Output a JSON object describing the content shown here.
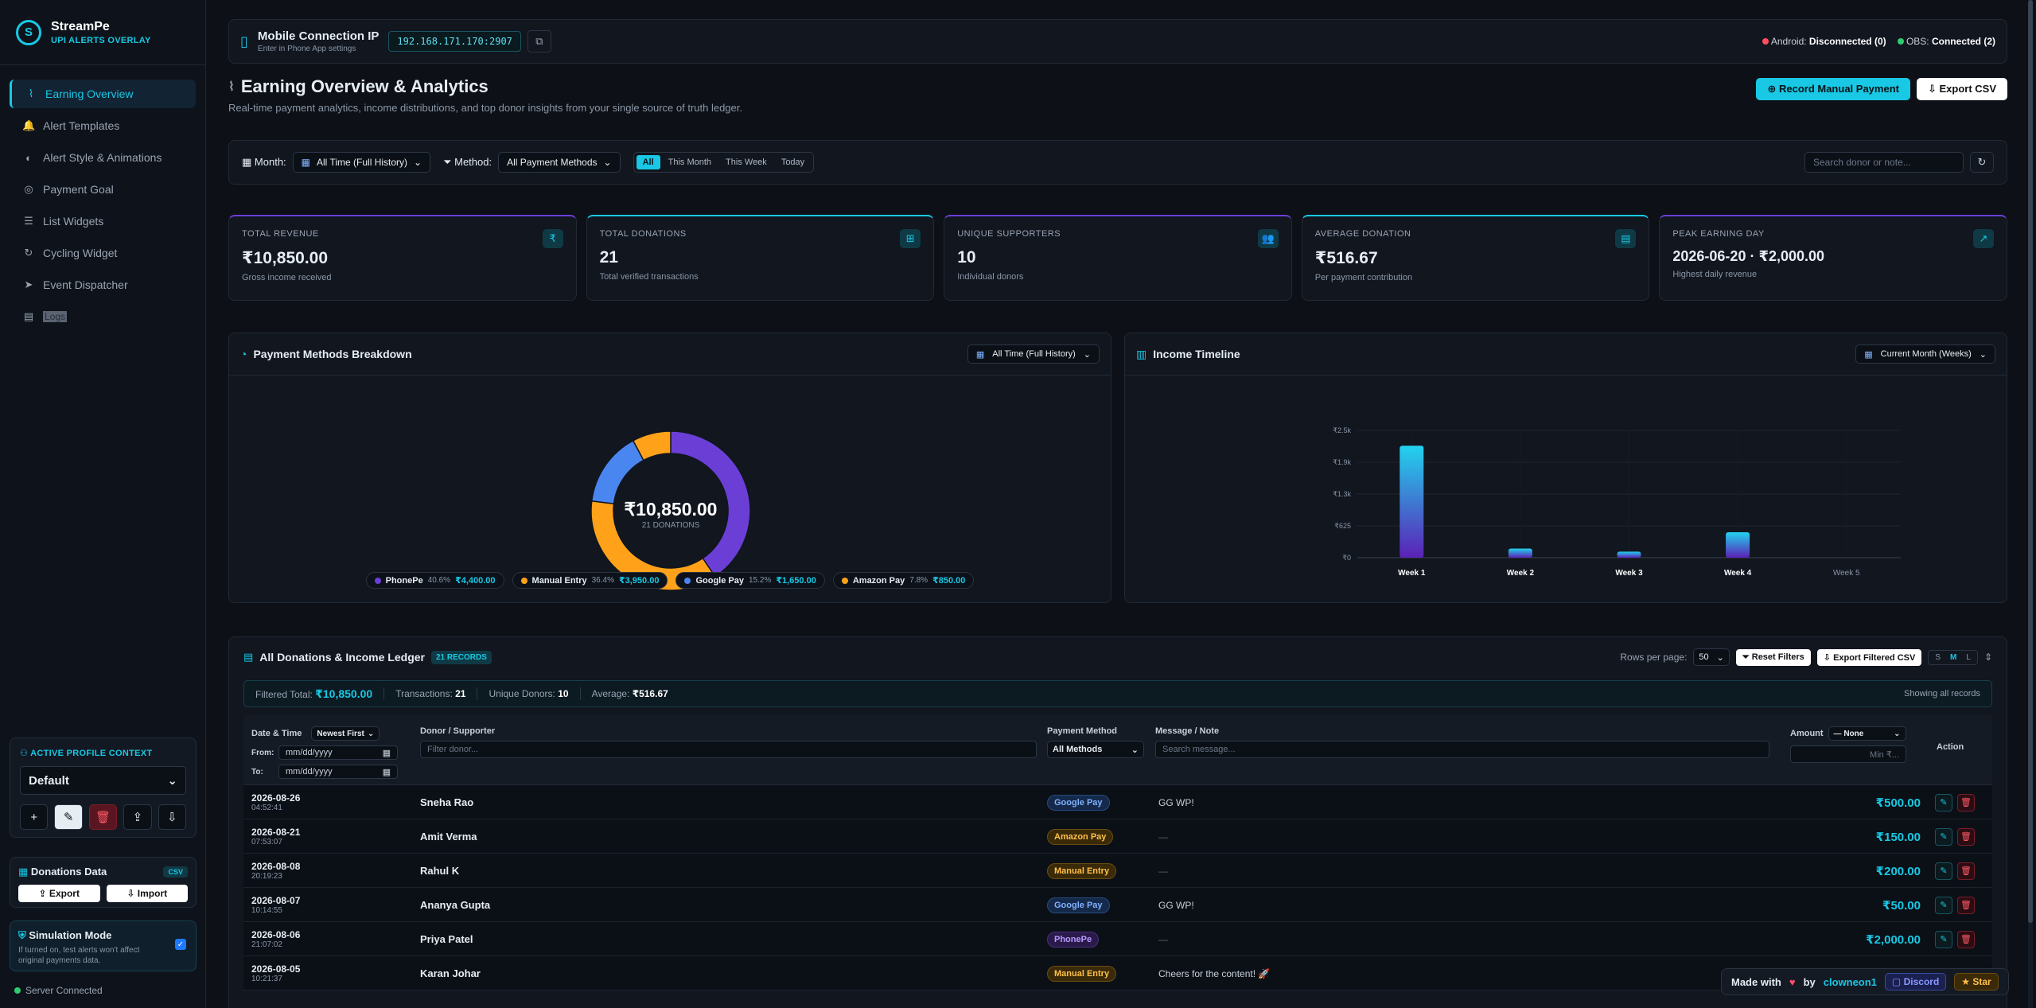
{
  "brand": {
    "name": "StreamPe",
    "sub": "UPI ALERTS OVERLAY",
    "logo": "S"
  },
  "nav": [
    {
      "label": "Earning Overview",
      "icon": "chart-icon",
      "glyph": "⌇"
    },
    {
      "label": "Alert Templates",
      "icon": "bell-icon",
      "glyph": "🔔"
    },
    {
      "label": "Alert Style & Animations",
      "icon": "palette-icon",
      "glyph": "◐"
    },
    {
      "label": "Payment Goal",
      "icon": "target-icon",
      "glyph": "◎"
    },
    {
      "label": "List Widgets",
      "icon": "list-icon",
      "glyph": "☰"
    },
    {
      "label": "Cycling Widget",
      "icon": "cycle-icon",
      "glyph": "↻"
    },
    {
      "label": "Event Dispatcher",
      "icon": "send-icon",
      "glyph": "➤"
    },
    {
      "label": "Logs",
      "icon": "clipboard-icon",
      "glyph": "▤"
    }
  ],
  "profile": {
    "title": "ACTIVE PROFILE CONTEXT",
    "value": "Default",
    "add": "+",
    "edit": "✎",
    "delete": "🗑",
    "upload": "⇪",
    "download": "⇩"
  },
  "donations_data": {
    "title": "Donations Data",
    "tag": "CSV",
    "export": "⇪ Export",
    "import": "⇩ Import"
  },
  "simulation": {
    "title": "Simulation Mode",
    "desc": "If turned on, test alerts won't affect original payments data.",
    "check": "✓"
  },
  "server": "Server Connected",
  "topbar": {
    "title": "Mobile Connection IP",
    "sub": "Enter in Phone App settings",
    "ip": "192.168.171.170:2907",
    "android_label": "Android:",
    "android_val": "Disconnected (0)",
    "obs_label": "OBS:",
    "obs_val": "Connected (2)",
    "copy": "⧉",
    "phone": "▯"
  },
  "page": {
    "title": "Earning Overview & Analytics",
    "subtitle": "Real-time payment analytics, income distributions, and top donor insights from your single source of truth ledger.",
    "record_btn": "⊕  Record Manual Payment",
    "export_btn": "⇩  Export CSV",
    "title_icon": "⌇"
  },
  "filters": {
    "month_label": "Month:",
    "month_val": "All Time (Full History)",
    "method_label": "Method:",
    "method_val": "All Payment Methods",
    "ranges": [
      "All",
      "This Month",
      "This Week",
      "Today"
    ],
    "search_ph": "Search donor or note...",
    "refresh": "↻",
    "cal": "▦",
    "funnel": "⏷",
    "chev": "⌄"
  },
  "stats": [
    {
      "label": "TOTAL REVENUE",
      "value": "₹10,850.00",
      "sub": "Gross income received",
      "icon": "rupee-icon",
      "glyph": "₹"
    },
    {
      "label": "TOTAL DONATIONS",
      "value": "21",
      "sub": "Total verified transactions",
      "icon": "gift-icon",
      "glyph": "⊞"
    },
    {
      "label": "UNIQUE SUPPORTERS",
      "value": "10",
      "sub": "Individual donors",
      "icon": "users-icon",
      "glyph": "👥"
    },
    {
      "label": "AVERAGE DONATION",
      "value": "₹516.67",
      "sub": "Per payment contribution",
      "icon": "calc-icon",
      "glyph": "▤"
    },
    {
      "label": "PEAK EARNING DAY",
      "value": "2026-06-20 · ₹2,000.00",
      "sub": "Highest daily revenue",
      "icon": "trend-icon",
      "glyph": "↗"
    }
  ],
  "donut": {
    "title": "Payment Methods Breakdown",
    "filter": "All Time (Full History)",
    "center_value": "₹10,850.00",
    "center_label": "21 DONATIONS",
    "slices": [
      {
        "name": "PhonePe",
        "pct": "40.6%",
        "amount": "₹4,400.00",
        "value": 4400,
        "color": "#6b3fd6"
      },
      {
        "name": "Manual Entry",
        "pct": "36.4%",
        "amount": "₹3,950.00",
        "value": 3950,
        "color": "#ffa21a"
      },
      {
        "name": "Google Pay",
        "pct": "15.2%",
        "amount": "₹1,650.00",
        "value": 1650,
        "color": "#4a86f0"
      },
      {
        "name": "Amazon Pay",
        "pct": "7.8%",
        "amount": "₹850.00",
        "value": 850,
        "color": "#ffa21a"
      }
    ]
  },
  "timeline": {
    "title": "Income Timeline",
    "filter": "Current Month (Weeks)"
  },
  "chart_data": {
    "type": "bar",
    "title": "Income Timeline",
    "categories": [
      "Week 1",
      "Week 2",
      "Week 3",
      "Week 4",
      "Week 5"
    ],
    "values": [
      2200,
      180,
      120,
      500,
      0
    ],
    "ylim": [
      0,
      2500
    ],
    "yticks": [
      "₹0",
      "₹625",
      "₹1.3k",
      "₹1.9k",
      "₹2.5k"
    ],
    "ytick_values": [
      0,
      625,
      1250,
      1875,
      2500
    ],
    "grid": true
  },
  "ledger": {
    "title": "All Donations & Income Ledger",
    "badge": "21 RECORDS",
    "rows_label": "Rows per page:",
    "rows_val": "50",
    "reset": "Reset Filters",
    "export": "Export Filtered CSV",
    "sizes": [
      "S",
      "M",
      "L"
    ],
    "summary": {
      "filtered_label": "Filtered Total:",
      "filtered_val": "₹10,850.00",
      "tx_label": "Transactions:",
      "tx_val": "21",
      "donors_label": "Unique Donors:",
      "donors_val": "10",
      "avg_label": "Average:",
      "avg_val": "₹516.67",
      "showing": "Showing all records"
    },
    "cols": {
      "date": "Date & Time",
      "sort": "Newest First",
      "from": "From:",
      "to": "To:",
      "date_ph": "mm/dd/yyyy",
      "donor": "Donor / Supporter",
      "donor_ph": "Filter donor...",
      "method": "Payment Method",
      "method_sel": "All Methods",
      "msg": "Message / Note",
      "msg_ph": "Search message...",
      "amount": "Amount",
      "amount_sel": "— None",
      "min_ph": "Min ₹...",
      "action": "Action"
    },
    "rows": [
      {
        "date": "2026-08-26",
        "time": "04:52:41",
        "name": "Sneha Rao",
        "method": "Google Pay",
        "m": "g",
        "msg": "GG WP!",
        "amount": "₹500.00"
      },
      {
        "date": "2026-08-21",
        "time": "07:53:07",
        "name": "Amit Verma",
        "method": "Amazon Pay",
        "m": "a",
        "msg": "—",
        "amount": "₹150.00"
      },
      {
        "date": "2026-08-08",
        "time": "20:19:23",
        "name": "Rahul K",
        "method": "Manual Entry",
        "m": "m",
        "msg": "—",
        "amount": "₹200.00"
      },
      {
        "date": "2026-08-07",
        "time": "10:14:55",
        "name": "Ananya Gupta",
        "method": "Google Pay",
        "m": "g",
        "msg": "GG WP!",
        "amount": "₹50.00"
      },
      {
        "date": "2026-08-06",
        "time": "21:07:02",
        "name": "Priya Patel",
        "method": "PhonePe",
        "m": "p",
        "msg": "—",
        "amount": "₹2,000.00"
      },
      {
        "date": "2026-08-05",
        "time": "10:21:37",
        "name": "Karan Johar",
        "method": "Manual Entry",
        "m": "m",
        "msg": "Cheers for the content! 🚀",
        "amount": ""
      }
    ]
  },
  "made": {
    "text": "Made with",
    "by": "by",
    "author": "clowneon1",
    "discord": "▢ Discord",
    "star": "★ Star",
    "heart": "♥"
  }
}
